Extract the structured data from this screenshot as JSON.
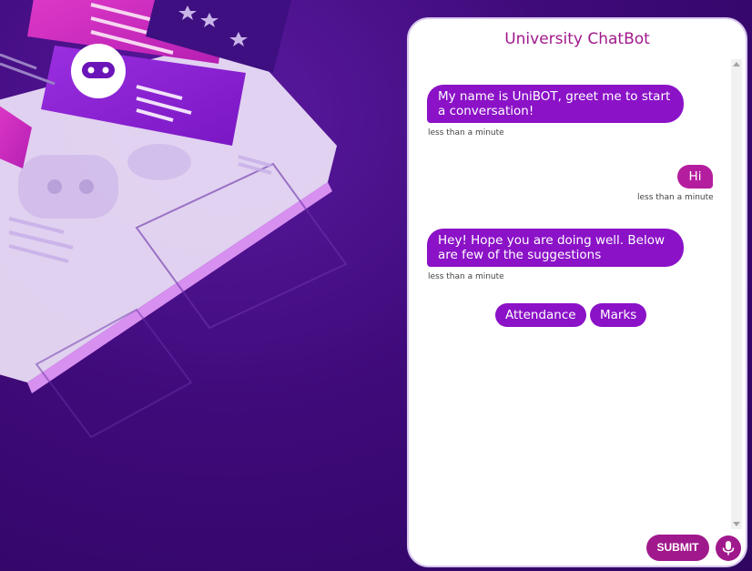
{
  "chat": {
    "title": "University ChatBot",
    "messages": [
      {
        "sender": "bot",
        "text": "My name is UniBOT, greet me to start a conversation!",
        "time": "less than a minute"
      },
      {
        "sender": "user",
        "text": "Hi",
        "time": "less than a minute"
      },
      {
        "sender": "bot",
        "text": "Hey! Hope you are doing well. Below are few of the suggestions",
        "time": "less than a minute"
      }
    ],
    "suggestions": [
      "Attendance",
      "Marks"
    ],
    "submit_label": "SUBMIT",
    "mic_icon": "microphone-icon"
  },
  "colors": {
    "bot_bubble": "#8b12c7",
    "user_bubble": "#b41e9e",
    "title": "#a0198c",
    "background": "#3f0a7a"
  }
}
